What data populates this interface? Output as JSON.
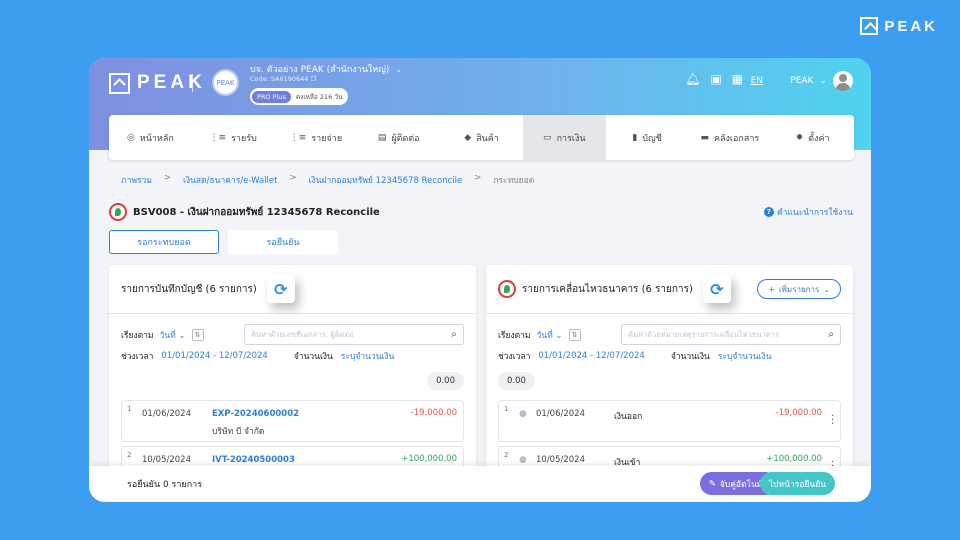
{
  "corner_logo": {
    "text": "PEAK"
  },
  "header": {
    "brand": "PEAK",
    "company_avatar_text": "PEAK",
    "company_name": "บจ. ตัวอย่าง PEAK (สำนักงานใหญ่)",
    "company_code": "Code: 5A6190644",
    "plan_badge": "PRO Plus",
    "plan_days": "คงเหลือ 216 วัน",
    "language": "EN",
    "user_name": "PEAK"
  },
  "nav": {
    "items": [
      {
        "label": "หน้าหลัก",
        "icon": "home-icon"
      },
      {
        "label": "รายรับ",
        "icon": "income-icon"
      },
      {
        "label": "รายจ่าย",
        "icon": "expense-icon"
      },
      {
        "label": "ผู้ติดต่อ",
        "icon": "contacts-icon"
      },
      {
        "label": "สินค้า",
        "icon": "product-icon"
      },
      {
        "label": "การเงิน",
        "icon": "finance-icon"
      },
      {
        "label": "บัญชี",
        "icon": "account-book-icon"
      },
      {
        "label": "คลังเอกสาร",
        "icon": "folder-icon"
      },
      {
        "label": "ตั้งค่า",
        "icon": "gear-icon"
      }
    ],
    "active_index": 5
  },
  "breadcrumb": {
    "items": [
      "ภาพรวม",
      "เงินสด/ธนาคาร/e-Wallet",
      "เงินฝากออมทรัพย์ 12345678 Reconcile",
      "กระทบยอด"
    ],
    "separator": ">"
  },
  "page": {
    "title": "BSV008 - เงินฝากออมทรัพย์ 12345678 Reconcile",
    "help_link": "คำแนะนำการใช้งาน",
    "tabs": [
      "รอกระทบยอด",
      "รอยืนยัน"
    ]
  },
  "left_panel": {
    "title": "รายการบันทึกบัญชี (6 รายการ)",
    "sort_label": "เรียงตาม",
    "sort_value": "วันที่",
    "search_placeholder": "ค้นหาด้วยเลขที่เอกสาร, ผู้ติดต่อ",
    "period_label": "ช่วงเวลา",
    "period_value": "01/01/2024 - 12/07/2024",
    "amount_label": "จำนวนเงิน",
    "amount_value": "ระบุจำนวนเงิน",
    "total": "0.00",
    "rows": [
      {
        "idx": "1",
        "date": "01/06/2024",
        "doc": "EXP-20240600002",
        "party": "บริษัท บี จำกัด",
        "amount": "-19,000.00"
      },
      {
        "idx": "2",
        "date": "10/05/2024",
        "doc": "IVT-20240500003",
        "party": "",
        "amount": "+100,000.00"
      }
    ]
  },
  "right_panel": {
    "title": "รายการเคลื่อนไหวธนาคาร (6 รายการ)",
    "add_button": "เพิ่มรายการ",
    "sort_label": "เรียงตาม",
    "sort_value": "วันที่",
    "search_placeholder": "ค้นหาด้วยหมายเหตุรายการเคลื่อนไหวธนาคาร",
    "period_label": "ช่วงเวลา",
    "period_value": "01/01/2024 - 12/07/2024",
    "amount_label": "จำนวนเงิน",
    "amount_value": "ระบุจำนวนเงิน",
    "total": "0.00",
    "rows": [
      {
        "idx": "1",
        "date": "01/06/2024",
        "type": "เงินออก",
        "amount": "-19,000.00"
      },
      {
        "idx": "2",
        "date": "10/05/2024",
        "type": "เงินเข้า",
        "amount": "+100,000.00"
      }
    ]
  },
  "footer": {
    "status": "รอยืนยัน 0 รายการ",
    "auto_match_button": "จับคู่อัตโนมัติ",
    "go_confirm_button": "ไปหน้ารอยืนยัน"
  },
  "colors": {
    "accent": "#2f7fd6",
    "background": "#3d9df0",
    "negative": "#e2574c",
    "positive": "#3aa356",
    "auto_match": "#7b6fe0",
    "go_confirm": "#44c6c9"
  }
}
